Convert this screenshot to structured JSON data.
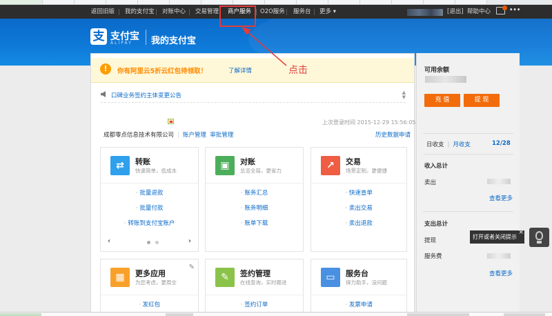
{
  "topnav": {
    "items": [
      "返回旧版",
      "我的支付宝",
      "对账中心",
      "交易管理",
      "商户服务",
      "O2O服务",
      "服务台",
      "更多"
    ],
    "logout": "[退出]",
    "help": "帮助中心",
    "mail_count": "1"
  },
  "header": {
    "logo_glyph": "支",
    "logo_text": "支付宝",
    "logo_sub": "ALIPAY",
    "page_title": "我的支付宝"
  },
  "notice": {
    "icon": "!",
    "text": "你有阿里云5折云红包待领取！",
    "link": "了解详情"
  },
  "annotation": {
    "callout": "点击"
  },
  "announcement": {
    "text": "口碑业务签约主体变更公告"
  },
  "account": {
    "last_login": "上次登录时间 2015-12-29 15:56:05",
    "company": "成都零点信息技术有限公司",
    "account_manage": "账户管理",
    "audit_manage": "审批管理",
    "history": "历史数据申请"
  },
  "cards": {
    "transfer": {
      "icon": "transfer-icon",
      "title": "转账",
      "sub": "快速简单，低成本",
      "links": [
        "批量退款",
        "批量付款",
        "转账到支付宝账户"
      ]
    },
    "reconcile": {
      "icon": "reconcile-icon",
      "title": "对账",
      "sub": "总览全局，更省力",
      "links": [
        "账务汇总",
        "账务明细",
        "账单下载"
      ]
    },
    "trade": {
      "icon": "trade-icon",
      "title": "交易",
      "sub": "场景定制，更便捷",
      "links": [
        "快速查单",
        "卖出交易",
        "卖出退款"
      ]
    },
    "apps": {
      "icon": "apps-grid-icon",
      "title": "更多应用",
      "sub": "为您考虑，更周全",
      "links": [
        "发红包"
      ]
    },
    "contract": {
      "icon": "contract-icon",
      "title": "签约管理",
      "sub": "在线查询，实时跟进",
      "links": [
        "签约订单"
      ]
    },
    "service": {
      "icon": "service-desk-icon",
      "title": "服务台",
      "sub": "得力助手，没问题",
      "links": [
        "发票申请"
      ]
    }
  },
  "right": {
    "balance_title": "可用余额",
    "recharge": "充 值",
    "withdraw": "提 现",
    "tab_day": "日收支",
    "tab_month": "月收支",
    "date": "12/28",
    "income_title": "收入总计",
    "income_item": "卖出",
    "view_more": "查看更多",
    "expense_title": "支出总计",
    "expense_item1": "提现",
    "expense_item2": "服务费"
  },
  "tooltip": {
    "text": "打开或者关闭提示",
    "close": "×"
  },
  "colors": {
    "header_blue": "#0f7ad9",
    "accent_orange": "#f26c0c",
    "link_blue": "#0a6ac9",
    "highlight_red": "#e23c3c"
  }
}
